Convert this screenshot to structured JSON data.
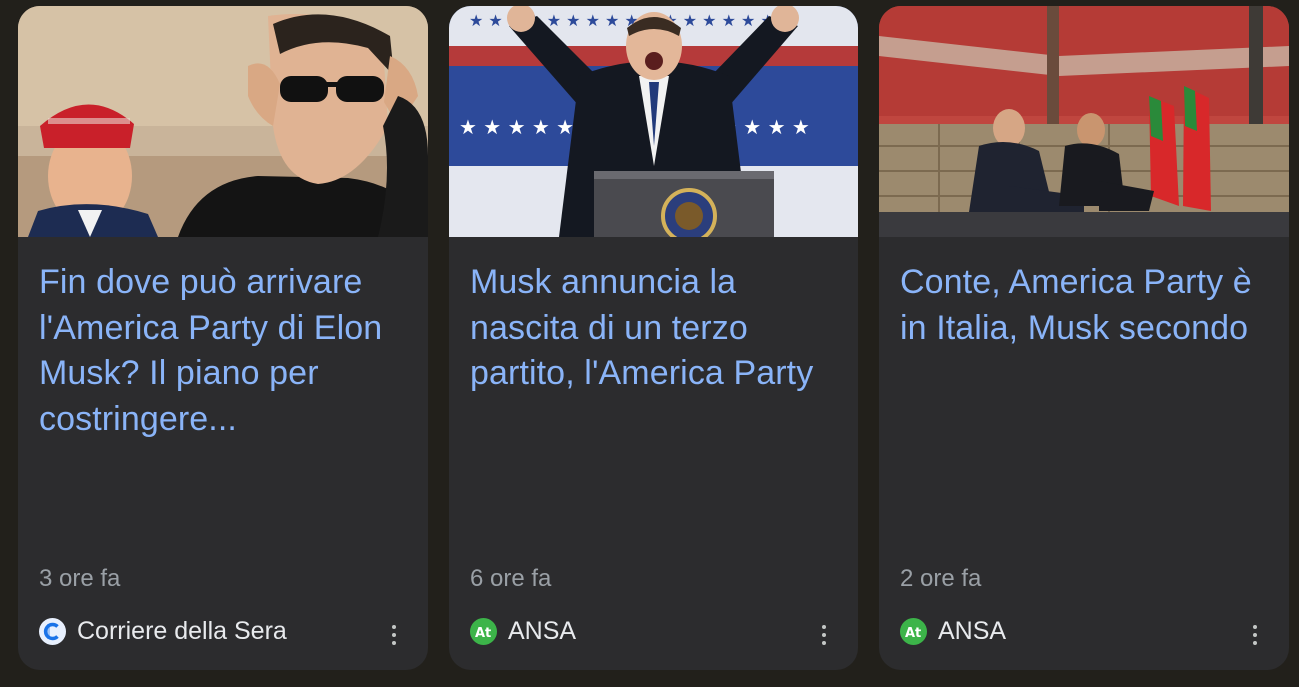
{
  "cards": [
    {
      "headline": "Fin dove può arrivare l'America Party di Elon Musk? Il piano per costringere...",
      "time": "3 ore fa",
      "source": "Corriere della Sera",
      "source_icon": "corriere-logo-icon",
      "image_alt": "Donald Trump and Elon Musk wearing sunglasses"
    },
    {
      "headline": "Musk annuncia la nascita di un terzo partito, l'America Party",
      "time": "6 ore fa",
      "source": "ANSA",
      "source_icon": "ansa-logo-icon",
      "image_alt": "Elon Musk raising arms behind presidential podium"
    },
    {
      "headline": "Conte, America Party è in Italia, Musk secondo",
      "time": "2 ore fa",
      "source": "ANSA",
      "source_icon": "ansa-logo-icon",
      "image_alt": "Giuseppe Conte seated on stage with flags"
    }
  ],
  "colors": {
    "background": "#22201b",
    "card": "#2c2c2e",
    "headline": "#8ab4f8",
    "time": "#9aa0a6",
    "source": "#e8eaed",
    "ansa_green": "#3cb449"
  }
}
